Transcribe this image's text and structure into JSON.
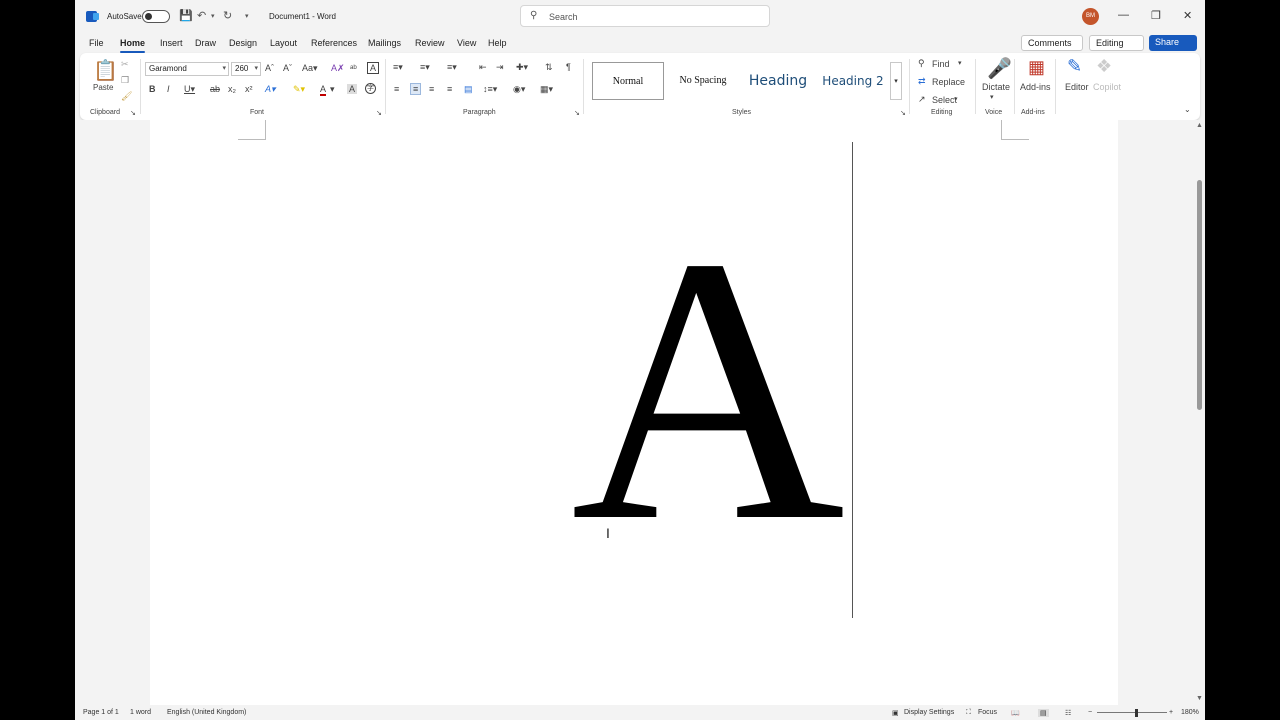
{
  "titlebar": {
    "autosave_label": "AutoSave",
    "doc_title": "Document1  -  Word",
    "search_placeholder": "Search",
    "avatar_initials": "BM"
  },
  "menu": {
    "tabs": [
      "File",
      "Home",
      "Insert",
      "Draw",
      "Design",
      "Layout",
      "References",
      "Mailings",
      "Review",
      "View",
      "Help"
    ],
    "active": "Home",
    "comments_label": "Comments",
    "editing_label": "Editing",
    "share_label": "Share"
  },
  "ribbon": {
    "clipboard": {
      "paste_label": "Paste",
      "group_label": "Clipboard"
    },
    "font": {
      "font_name": "Garamond",
      "font_size": "260",
      "group_label": "Font"
    },
    "paragraph": {
      "group_label": "Paragraph"
    },
    "styles": {
      "normal": "Normal",
      "no_spacing": "No Spacing",
      "heading1": "Heading",
      "heading2": "Heading 2",
      "group_label": "Styles"
    },
    "editing": {
      "find": "Find",
      "replace": "Replace",
      "select": "Select",
      "group_label": "Editing"
    },
    "voice": {
      "dictate": "Dictate",
      "group_label": "Voice"
    },
    "addins": {
      "addins": "Add-ins",
      "group_label": "Add-ins"
    },
    "editor": {
      "editor": "Editor",
      "copilot": "Copilot"
    }
  },
  "document": {
    "content": "A"
  },
  "status": {
    "page": "Page 1 of 1",
    "words": "1 word",
    "language": "English (United Kingdom)",
    "display_settings": "Display Settings",
    "focus": "Focus",
    "zoom": "180%"
  },
  "colors": {
    "accent": "#185abd",
    "avatar": "#c4552b"
  }
}
